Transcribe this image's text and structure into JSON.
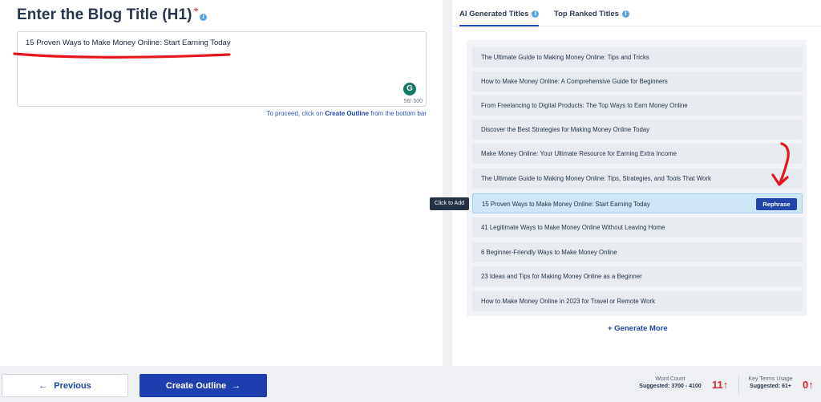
{
  "editor": {
    "heading": "Enter the Blog Title (H1)",
    "required_mark": "*",
    "info_mark": "i",
    "title_value": "15 Proven Ways to Make Money Online: Start Earning Today",
    "char_count": "56/ 500",
    "grammarly_label": "G",
    "proceed_prefix": "To proceed, click on ",
    "proceed_link": "Create Outline",
    "proceed_suffix": " from the bottom bar"
  },
  "tabs": [
    {
      "label": "AI Generated Titles",
      "active": true
    },
    {
      "label": "Top Ranked Titles",
      "active": false
    }
  ],
  "titles": [
    "The Ultimate Guide to Making Money Online: Tips and Tricks",
    "How to Make Money Online: A Comprehensive Guide for Beginners",
    "From Freelancing to Digital Products: The Top Ways to Earn Money Online",
    "Discover the Best Strategies for Making Money Online Today",
    "Make Money Online: Your Ultimate Resource for Earning Extra Income",
    "The Ultimate Guide to Making Money Online: Tips, Strategies, and Tools That Work",
    "15 Proven Ways to Make Money Online: Start Earning Today",
    "41 Legitimate Ways to Make Money Online Without Leaving Home",
    "6 Beginner-Friendly Ways to Make Money Online",
    "23 Ideas and Tips for Making Money Online as a Beginner",
    "How to Make Money Online in 2023 for Travel or Remote Work"
  ],
  "selected_index": 6,
  "rephrase_label": "Rephrase",
  "tooltip": "Click to Add",
  "generate_more": "+ Generate More",
  "footer": {
    "previous_label": "Previous",
    "previous_icon": "←",
    "create_label": "Create Outline",
    "create_icon": "→",
    "word_count_label": "Word Count",
    "word_count_suggested": "Suggested: 3700 - 4100",
    "word_count_value": "11",
    "key_terms_label": "Key Terms Usage",
    "key_terms_suggested": "Suggested: 61+",
    "key_terms_value": "0",
    "up_arrow": "↑"
  },
  "colors": {
    "accent": "#1e40af",
    "alert": "#e0212f",
    "annotation": "#e6161d"
  }
}
